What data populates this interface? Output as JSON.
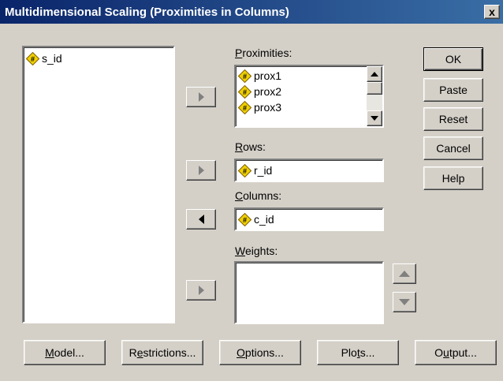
{
  "window": {
    "title": "Multidimensional Scaling (Proximities in Columns)",
    "close_glyph": "x"
  },
  "source_list": {
    "items": [
      {
        "label": "s_id",
        "icon": "numeric-variable-icon"
      }
    ]
  },
  "proximities": {
    "label_mnemonic": "P",
    "label_rest": "roximities:",
    "items": [
      {
        "label": "prox1",
        "icon": "numeric-variable-icon"
      },
      {
        "label": "prox2",
        "icon": "numeric-variable-icon"
      },
      {
        "label": "prox3",
        "icon": "numeric-variable-icon"
      }
    ]
  },
  "rows": {
    "label_mnemonic": "R",
    "label_rest": "ows:",
    "value": "r_id"
  },
  "columns": {
    "label_mnemonic": "C",
    "label_rest": "olumns:",
    "value": "c_id"
  },
  "weights": {
    "label_mnemonic": "W",
    "label_rest": "eights:"
  },
  "side_buttons": {
    "ok": "OK",
    "paste": "Paste",
    "reset": "Reset",
    "cancel": "Cancel",
    "help": "Help"
  },
  "bottom_buttons": {
    "model": {
      "mnemonic": "M",
      "rest": "odel..."
    },
    "restrictions": {
      "pre": "R",
      "mnemonic": "e",
      "rest": "strictions..."
    },
    "options": {
      "mnemonic": "O",
      "rest": "ptions..."
    },
    "plots": {
      "pre": "Plo",
      "mnemonic": "t",
      "rest": "s..."
    },
    "output": {
      "pre": "O",
      "mnemonic": "u",
      "rest": "tput..."
    }
  },
  "colors": {
    "title_bar": "#0a246a",
    "dialog_bg": "#d4d0c8",
    "icon_yellow": "#f0d000"
  }
}
